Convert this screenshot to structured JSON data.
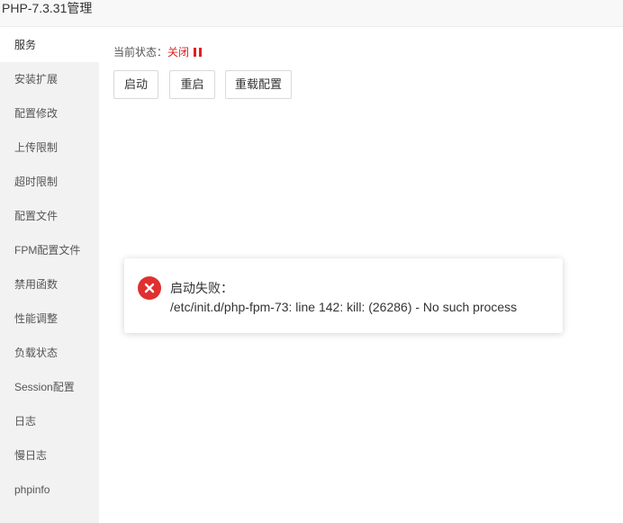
{
  "window": {
    "title": "PHP-7.3.31管理"
  },
  "sidebar": {
    "items": [
      {
        "label": "服务"
      },
      {
        "label": "安装扩展"
      },
      {
        "label": "配置修改"
      },
      {
        "label": "上传限制"
      },
      {
        "label": "超时限制"
      },
      {
        "label": "配置文件"
      },
      {
        "label": "FPM配置文件"
      },
      {
        "label": "禁用函数"
      },
      {
        "label": "性能调整"
      },
      {
        "label": "负载状态"
      },
      {
        "label": "Session配置"
      },
      {
        "label": "日志"
      },
      {
        "label": "慢日志"
      },
      {
        "label": "phpinfo"
      }
    ],
    "active_index": 0
  },
  "service": {
    "status_label": "当前状态：",
    "status_value": "关闭",
    "status_icon": "pause-icon",
    "status_color": "#e02020",
    "buttons": {
      "start": "启动",
      "restart": "重启",
      "reload": "重载配置"
    }
  },
  "toast": {
    "icon": "error-icon",
    "icon_color": "#e02f2f",
    "title": "启动失败：",
    "message": "/etc/init.d/php-fpm-73: line 142: kill: (26286) - No such process"
  }
}
